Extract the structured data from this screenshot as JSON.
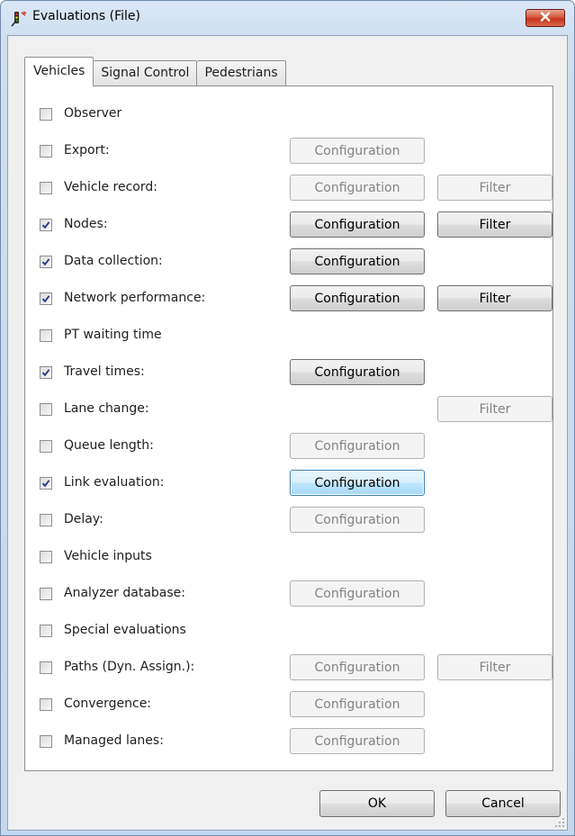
{
  "window": {
    "title": "Evaluations (File)"
  },
  "tabs": [
    {
      "label": "Vehicles",
      "active": true
    },
    {
      "label": "Signal Control",
      "active": false
    },
    {
      "label": "Pedestrians",
      "active": false
    }
  ],
  "rows": [
    {
      "label": "Observer",
      "checked": false,
      "config": null,
      "filter": null
    },
    {
      "label": "Export:",
      "checked": false,
      "config": {
        "label": "Configuration",
        "enabled": false
      },
      "filter": null
    },
    {
      "label": "Vehicle record:",
      "checked": false,
      "config": {
        "label": "Configuration",
        "enabled": false
      },
      "filter": {
        "label": "Filter",
        "enabled": false
      }
    },
    {
      "label": "Nodes:",
      "checked": true,
      "config": {
        "label": "Configuration",
        "enabled": true
      },
      "filter": {
        "label": "Filter",
        "enabled": true
      }
    },
    {
      "label": "Data collection:",
      "checked": true,
      "config": {
        "label": "Configuration",
        "enabled": true
      },
      "filter": null
    },
    {
      "label": "Network performance:",
      "checked": true,
      "config": {
        "label": "Configuration",
        "enabled": true
      },
      "filter": {
        "label": "Filter",
        "enabled": true
      }
    },
    {
      "label": "PT waiting time",
      "checked": false,
      "config": null,
      "filter": null
    },
    {
      "label": "Travel times:",
      "checked": true,
      "config": {
        "label": "Configuration",
        "enabled": true
      },
      "filter": null
    },
    {
      "label": "Lane change:",
      "checked": false,
      "config": null,
      "filter": {
        "label": "Filter",
        "enabled": false
      }
    },
    {
      "label": "Queue length:",
      "checked": false,
      "config": {
        "label": "Configuration",
        "enabled": false
      },
      "filter": null
    },
    {
      "label": "Link evaluation:",
      "checked": true,
      "config": {
        "label": "Configuration",
        "enabled": true,
        "focused": true
      },
      "filter": null
    },
    {
      "label": "Delay:",
      "checked": false,
      "config": {
        "label": "Configuration",
        "enabled": false
      },
      "filter": null
    },
    {
      "label": "Vehicle inputs",
      "checked": false,
      "config": null,
      "filter": null
    },
    {
      "label": "Analyzer database:",
      "checked": false,
      "config": {
        "label": "Configuration",
        "enabled": false
      },
      "filter": null
    },
    {
      "label": "Special evaluations",
      "checked": false,
      "config": null,
      "filter": null
    },
    {
      "label": "Paths (Dyn. Assign.):",
      "checked": false,
      "config": {
        "label": "Configuration",
        "enabled": false
      },
      "filter": {
        "label": "Filter",
        "enabled": false
      }
    },
    {
      "label": "Convergence:",
      "checked": false,
      "config": {
        "label": "Configuration",
        "enabled": false
      },
      "filter": null
    },
    {
      "label": "Managed lanes:",
      "checked": false,
      "config": {
        "label": "Configuration",
        "enabled": false
      },
      "filter": null
    }
  ],
  "footer": {
    "ok_label": "OK",
    "cancel_label": "Cancel"
  },
  "icons": {
    "app": "traffic-signal-icon",
    "close": "close-icon",
    "check": "check-icon",
    "resize": "resize-grip-icon"
  },
  "colors": {
    "close_button": "#c5351b",
    "focus_border": "#3c7fb1",
    "window_frame": "#cfdff1"
  }
}
